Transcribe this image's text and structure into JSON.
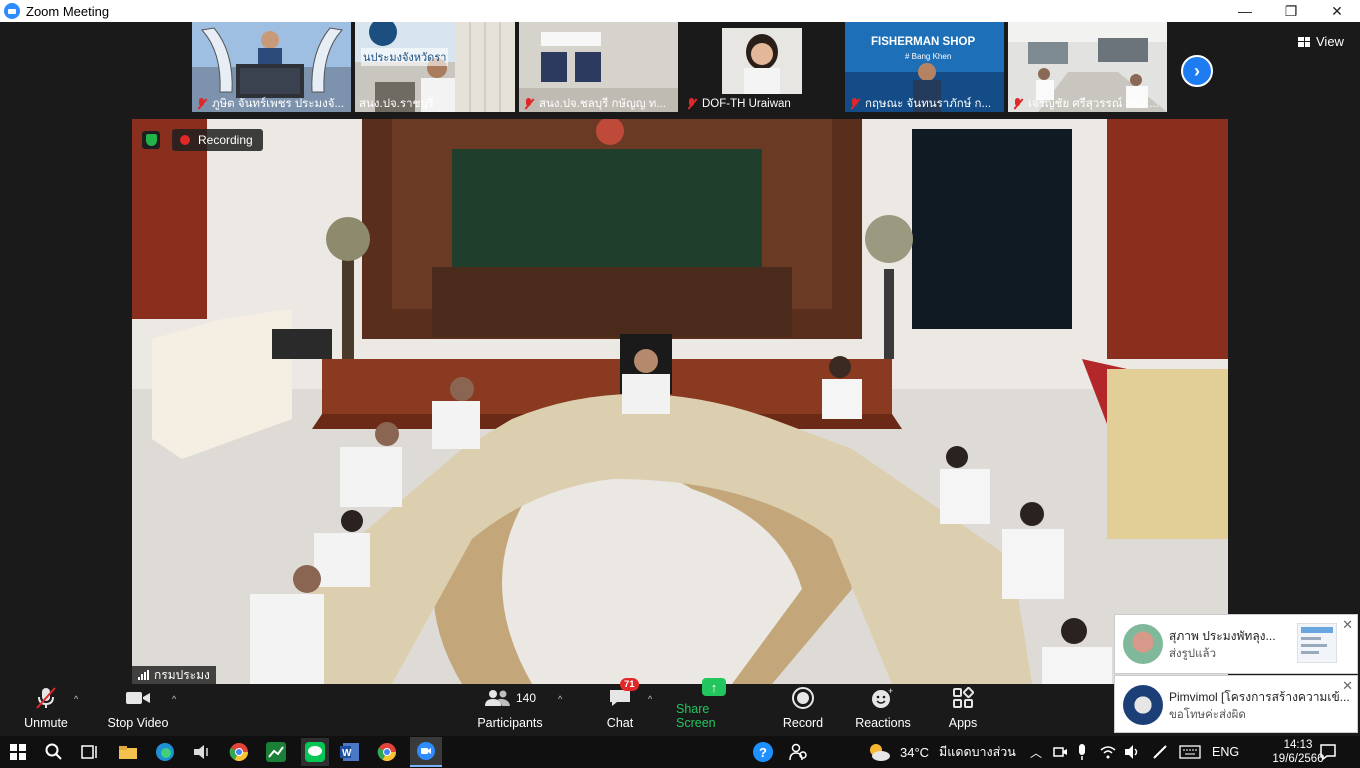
{
  "window": {
    "title": "Zoom Meeting",
    "minimize": "—",
    "maximize": "❐",
    "close": "✕"
  },
  "view_button": {
    "label": "View"
  },
  "thumbnails": [
    {
      "name": "ภูษิต จันทร์เพชร ประมงจั...",
      "muted": true
    },
    {
      "name": "สนง.ปจ.ราชบุรี",
      "muted": false,
      "sign_text": "นประมงจังหวัดรา"
    },
    {
      "name": "สนง.ปจ.ชลบุรี กษัญญ ท...",
      "muted": true
    },
    {
      "name": "DOF-TH Uraiwan",
      "muted": true
    },
    {
      "name": "กฤษณะ จันทนราภักษ์ ก...",
      "muted": true,
      "banner": "FISHERMAN SHOP",
      "banner_sub": "# Bang Khen"
    },
    {
      "name": "เจริญชัย ศรีสุวรรณ์ สนง....",
      "muted": true
    }
  ],
  "main_video": {
    "recording_label": "Recording",
    "speaker_name": "กรมประมง"
  },
  "toolbar": {
    "unmute": "Unmute",
    "stop_video": "Stop Video",
    "participants": "Participants",
    "participants_count": "140",
    "chat": "Chat",
    "chat_badge": "71",
    "share_screen": "Share Screen",
    "record": "Record",
    "reactions": "Reactions",
    "apps": "Apps"
  },
  "notifications": [
    {
      "name": "สุภาพ ประมงพัทลุง...",
      "message": "ส่งรูปแล้ว"
    },
    {
      "name": "Pimvimol [โครงการสร้างความเข้...",
      "message": "ขอโทษค่ะส่งผิด"
    }
  ],
  "taskbar": {
    "weather_temp": "34°C",
    "weather_text": "มีแดดบางส่วน",
    "language": "ENG",
    "time": "14:13",
    "date": "19/6/2566"
  },
  "colors": {
    "zoom_blue": "#2d8cff",
    "muted_red": "#e02828",
    "share_green": "#22c55e",
    "background": "#1a1a1a"
  }
}
